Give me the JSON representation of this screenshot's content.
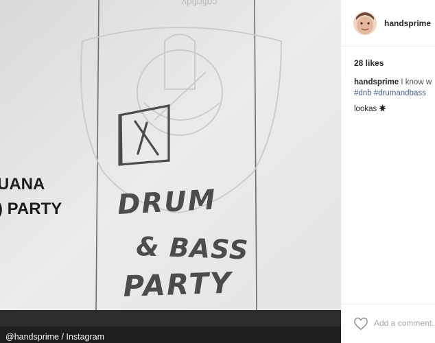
{
  "photo": {
    "credit": "@handsprime / Instagram",
    "printed_text_lines": [
      "UANA",
      ") PARTY"
    ],
    "handwriting_lines": [
      "DRUM",
      "& BASS",
      "PARTY"
    ],
    "colors": {
      "paper": "#e6e6e4",
      "pencil": "#4c4c4c",
      "print": "#1c1c1c"
    }
  },
  "post": {
    "username": "handsprime",
    "likes": "28 likes",
    "caption": {
      "username": "handsprime",
      "text": "I know w",
      "hashtags": "#dnb #drumandbass"
    },
    "comment": {
      "username": "lookas",
      "icon": "burst-icon"
    },
    "add_comment_placeholder": "Add a comment..."
  }
}
